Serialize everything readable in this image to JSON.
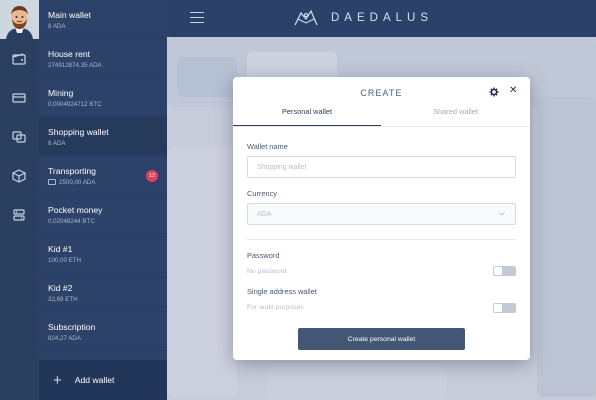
{
  "app": {
    "brand_name": "DAEDALUS"
  },
  "sidebar": {
    "rail_icons": [
      "wallet-icon",
      "card-icon",
      "exchange-icon",
      "box-icon",
      "settings-icon"
    ],
    "wallets": [
      {
        "name": "Main wallet",
        "balance": "8 ADA"
      },
      {
        "name": "House rent",
        "balance": "274912874,35 ADA"
      },
      {
        "name": "Mining",
        "balance": "0,0004924712 BTC"
      },
      {
        "name": "Shopping wallet",
        "balance": "8 ADA",
        "active": true
      },
      {
        "name": "Transporting",
        "balance": "2500,00 ADA",
        "badge": "12"
      },
      {
        "name": "Pocket money",
        "balance": "0,02048244 BTC"
      },
      {
        "name": "Kid #1",
        "balance": "100,00 ETH"
      },
      {
        "name": "Kid #2",
        "balance": "32,69 ETH"
      },
      {
        "name": "Subscription",
        "balance": "824,27 ADA"
      }
    ],
    "add_wallet_label": "Add wallet"
  },
  "dialog": {
    "title": "CREATE",
    "tabs": {
      "personal": "Personal wallet",
      "shared": "Shared wallet"
    },
    "wallet_name": {
      "label": "Wallet name",
      "placeholder": "Shopping wallet"
    },
    "currency": {
      "label": "Currency",
      "value": "ADA"
    },
    "password": {
      "label": "Password",
      "hint": "No password",
      "enabled": false
    },
    "single_address": {
      "label": "Single address wallet",
      "hint": "For audit purposes",
      "enabled": false
    },
    "submit_label": "Create personal wallet"
  },
  "colors": {
    "sidebar": "#2d4268",
    "rail": "#2b3f60",
    "topbar": "#2c4169",
    "primary_button": "#435775",
    "badge": "#e2415a"
  }
}
